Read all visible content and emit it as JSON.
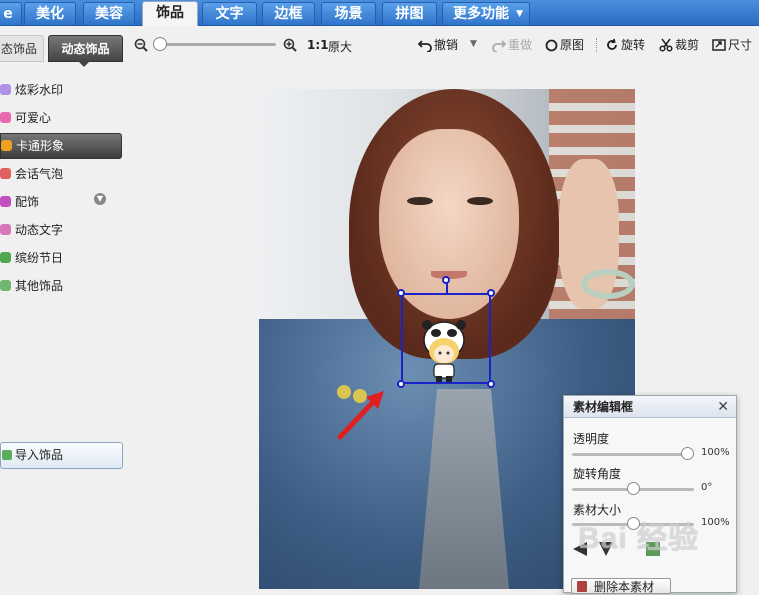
{
  "nav": {
    "tabs": [
      {
        "label": "e",
        "active": false
      },
      {
        "label": "美化",
        "active": false
      },
      {
        "label": "美容",
        "active": false
      },
      {
        "label": "饰品",
        "active": true
      },
      {
        "label": "文字",
        "active": false
      },
      {
        "label": "边框",
        "active": false
      },
      {
        "label": "场景",
        "active": false
      },
      {
        "label": "拼图",
        "active": false
      },
      {
        "label": "更多功能",
        "active": false
      }
    ]
  },
  "subtabs": [
    {
      "label": "态饰品",
      "active": false
    },
    {
      "label": "动态饰品",
      "active": true
    }
  ],
  "toolbar": {
    "zoom_one_to_one": "1:1",
    "original_size": "原大",
    "undo": "撤销",
    "redo": "重做",
    "original_image": "原图",
    "rotate": "旋转",
    "crop": "裁剪",
    "size": "尺寸"
  },
  "sidebar": {
    "items": [
      {
        "label": "炫彩水印",
        "color": "#a070d8"
      },
      {
        "label": "可爱心",
        "color": "#e05aa0"
      },
      {
        "label": "卡通形象",
        "color": "#f0a020",
        "active": true
      },
      {
        "label": "会话气泡",
        "color": "#d04040"
      },
      {
        "label": "配饰",
        "color": "#c040c0"
      },
      {
        "label": "动态文字",
        "color": "#d070b0"
      },
      {
        "label": "缤纷节日",
        "color": "#40a040"
      },
      {
        "label": "其他饰品",
        "color": "#60b060"
      }
    ],
    "import_label": "导入饰品"
  },
  "panel": {
    "title": "素材编辑框",
    "opacity_label": "透明度",
    "opacity_value": "100%",
    "opacity_level": 1.0,
    "rotation_label": "旋转角度",
    "rotation_value": "0°",
    "rotation_level": 0.5,
    "size_label": "素材大小",
    "size_value": "100%",
    "size_level": 0.5,
    "delete_label": "删除本素材"
  },
  "watermark": {
    "text": "Bai 经验"
  },
  "colors": {
    "nav_blue": "#2a6cc4",
    "selection_blue": "#1a23c8",
    "arrow_red": "#e02020"
  }
}
